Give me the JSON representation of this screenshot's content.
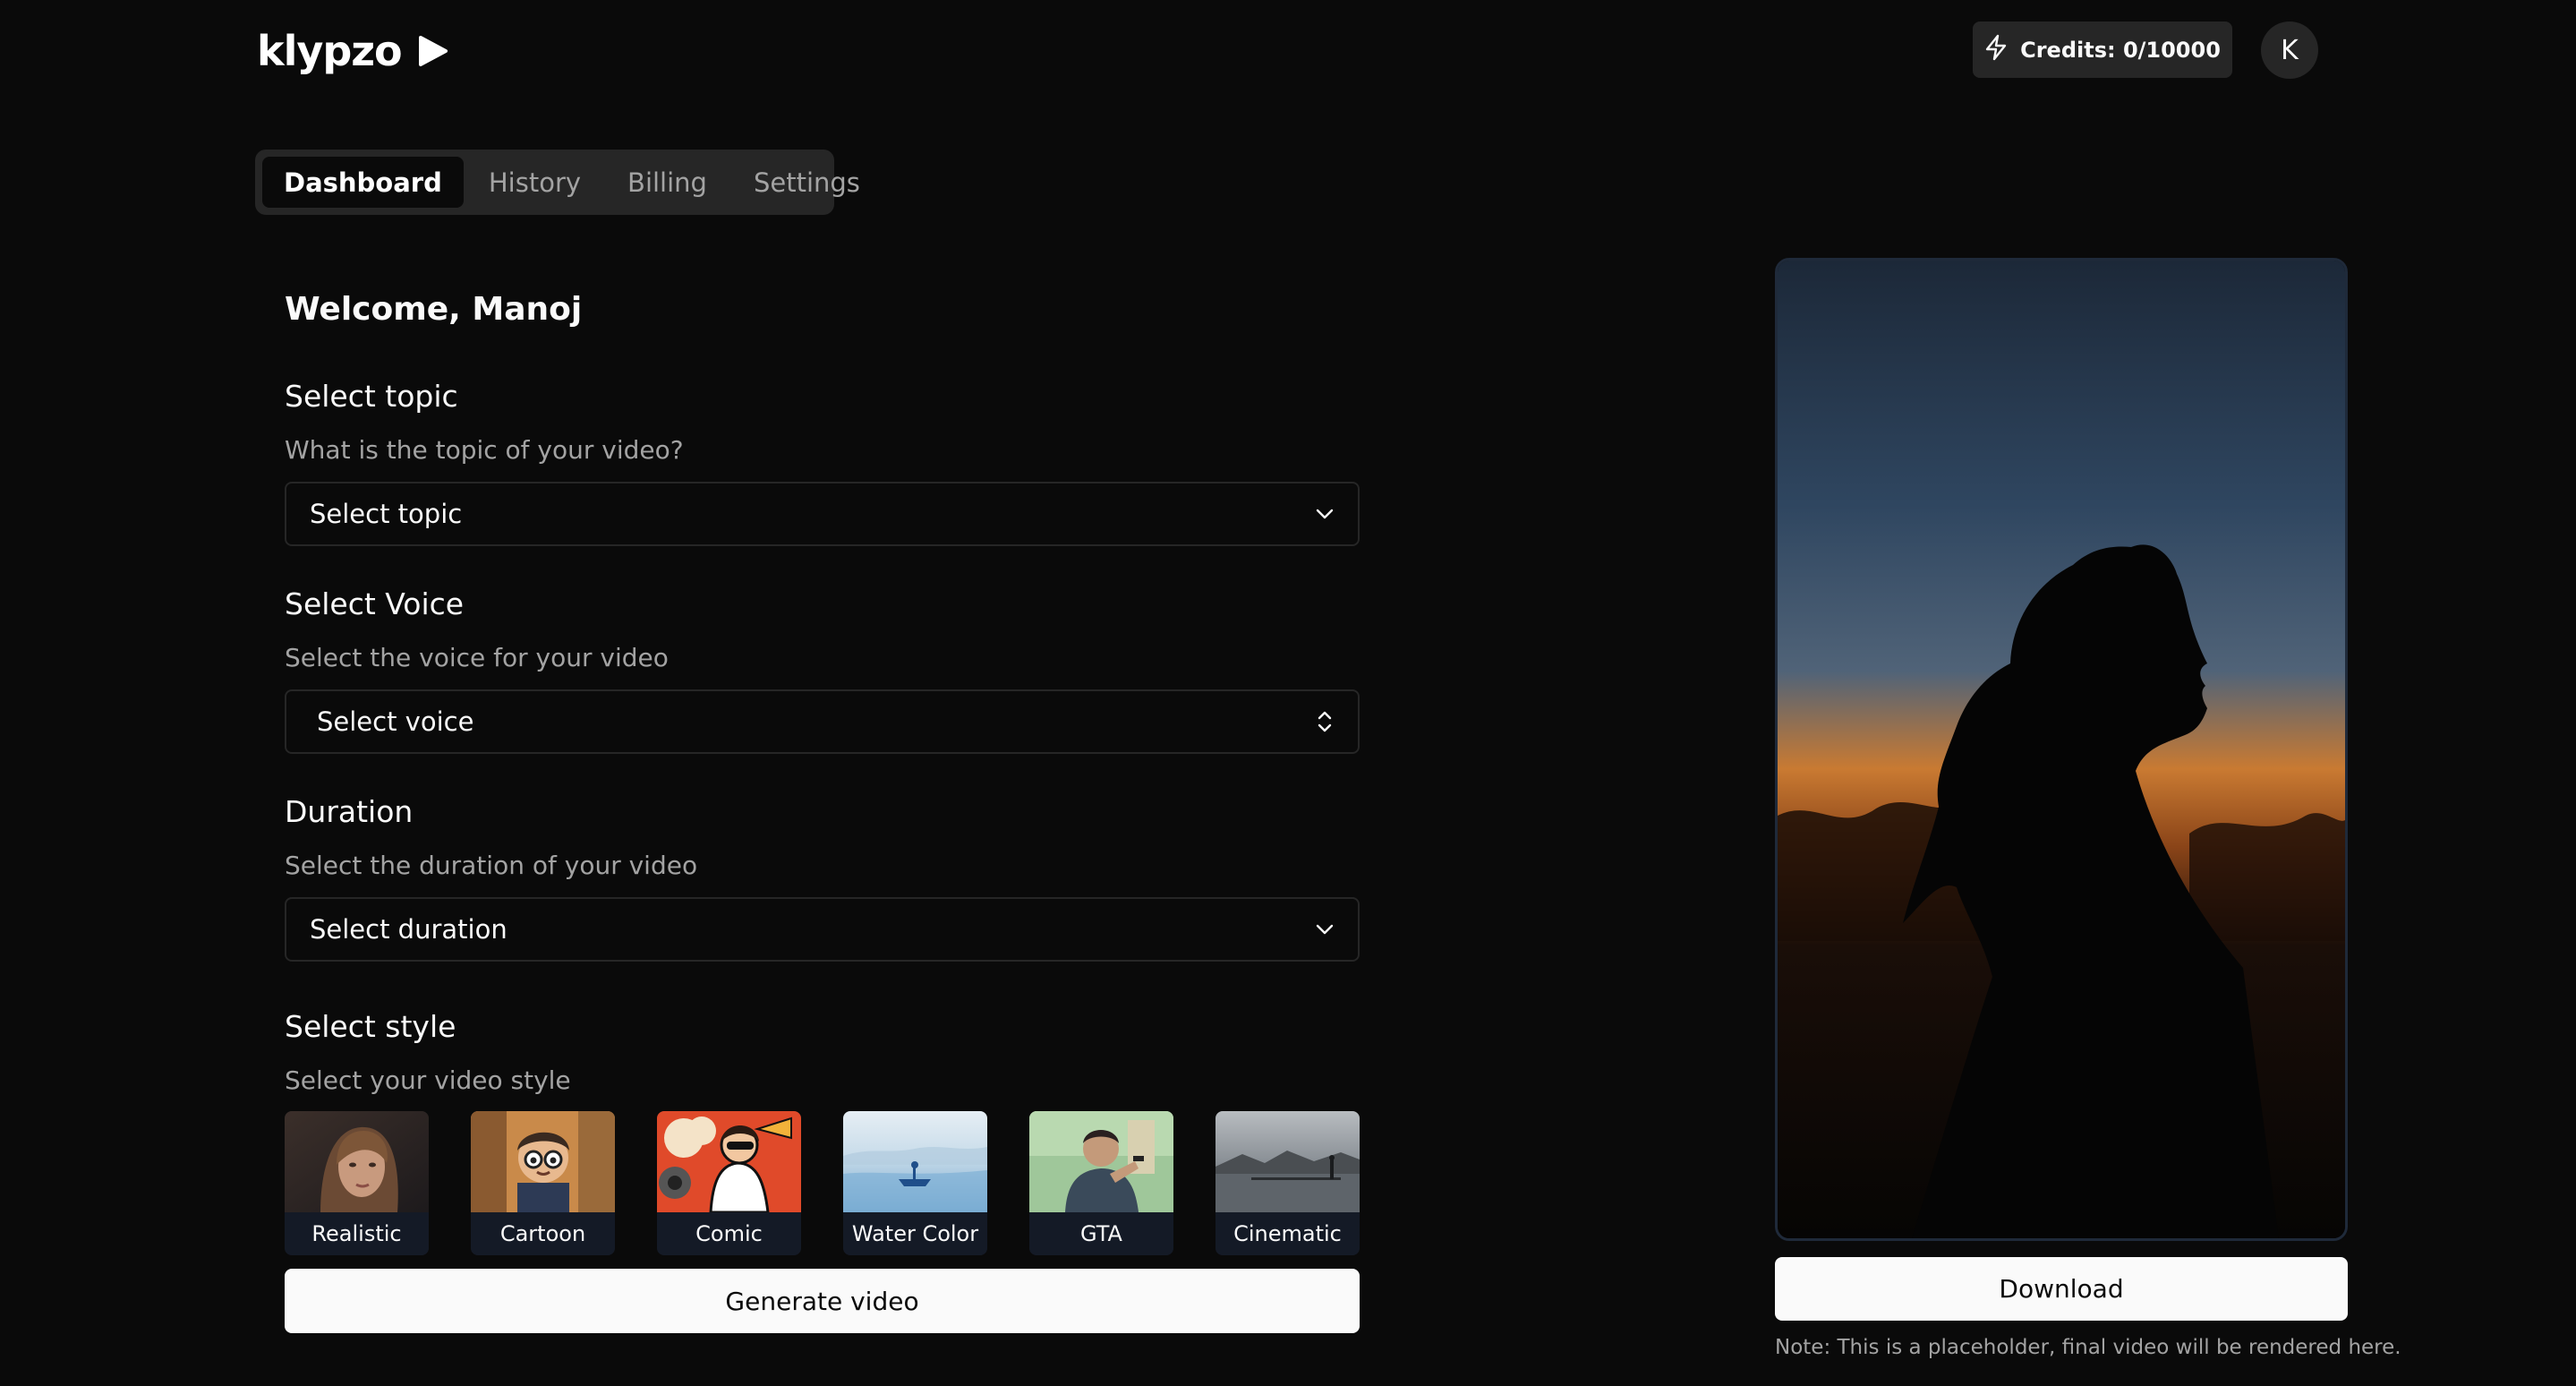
{
  "header": {
    "logo_text": "klypzo",
    "credits_label": "Credits: 0/10000",
    "avatar_initial": "K"
  },
  "tabs": [
    {
      "label": "Dashboard",
      "active": true
    },
    {
      "label": "History",
      "active": false
    },
    {
      "label": "Billing",
      "active": false
    },
    {
      "label": "Settings",
      "active": false
    }
  ],
  "form": {
    "welcome": "Welcome, Manoj",
    "topic": {
      "title": "Select topic",
      "description": "What is the topic of your video?",
      "value": "Select topic"
    },
    "voice": {
      "title": "Select Voice",
      "description": "Select the voice for your video",
      "value": "Select voice"
    },
    "duration": {
      "title": "Duration",
      "description": "Select the duration of your video",
      "value": "Select duration"
    },
    "style": {
      "title": "Select style",
      "description": "Select your video style",
      "options": [
        {
          "label": "Realistic",
          "icon": "realistic-thumbnail"
        },
        {
          "label": "Cartoon",
          "icon": "cartoon-thumbnail"
        },
        {
          "label": "Comic",
          "icon": "comic-thumbnail"
        },
        {
          "label": "Water Color",
          "icon": "watercolor-thumbnail"
        },
        {
          "label": "GTA",
          "icon": "gta-thumbnail"
        },
        {
          "label": "Cinematic",
          "icon": "cinematic-thumbnail"
        }
      ]
    },
    "generate_label": "Generate video"
  },
  "preview": {
    "download_label": "Download",
    "note": "Note: This is a placeholder, final video will be rendered here."
  },
  "colors": {
    "background": "#0a0a0a",
    "surface": "#262626",
    "text_primary": "#fafafa",
    "text_muted": "#a3a3a3",
    "button_bg": "#fafafa"
  }
}
